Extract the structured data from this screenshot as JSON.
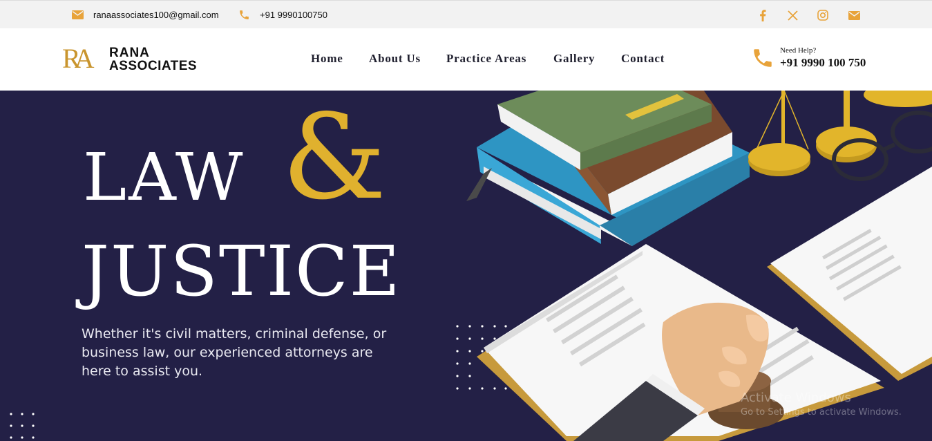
{
  "topbar": {
    "email": "ranaassociates100@gmail.com",
    "phone": "+91 9990100750",
    "social": [
      "facebook-icon",
      "x-icon",
      "instagram-icon",
      "email-icon"
    ]
  },
  "header": {
    "logo": {
      "mark": "RA",
      "line1": "RANA",
      "line2": "ASSOCIATES"
    },
    "nav": [
      "Home",
      "About Us",
      "Practice Areas",
      "Gallery",
      "Contact"
    ],
    "help": {
      "label": "Need Help?",
      "phone": "+91 9990 100 750"
    }
  },
  "hero": {
    "word1": "LAW",
    "amp": "&",
    "word2": "JUSTICE",
    "description": "Whether it's civil matters, criminal defense, or business law, our experienced attorneys are here to assist you."
  },
  "watermark": {
    "title": "Activate Windows",
    "subtitle": "Go to Settings to activate Windows."
  },
  "colors": {
    "accent": "#e8a33a",
    "gold": "#e0b12e",
    "hero_bg": "#232046"
  }
}
